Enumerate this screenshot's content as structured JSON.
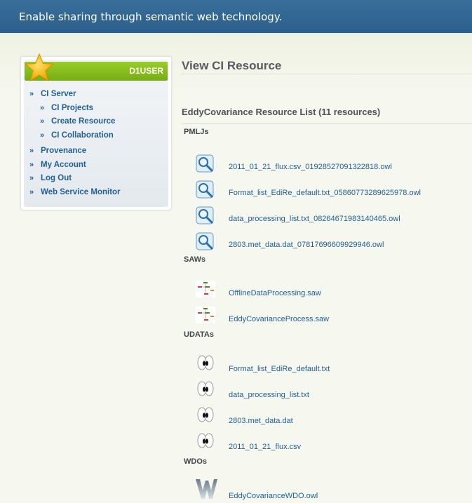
{
  "header": {
    "tagline": "Enable sharing through semantic web technology."
  },
  "sidebar": {
    "username": "D1USER",
    "items": [
      {
        "label": "CI Server"
      },
      {
        "label": "CI Projects"
      },
      {
        "label": "Create Resource"
      },
      {
        "label": "CI Collaboration"
      },
      {
        "label": "Provenance"
      },
      {
        "label": "My Account"
      },
      {
        "label": "Log Out"
      },
      {
        "label": "Web Service Monitor"
      }
    ]
  },
  "main": {
    "title": "View CI Resource",
    "list_heading": "EddyCovariance Resource List (11 resources)",
    "sections": [
      {
        "label": "PMLJs",
        "icon": "magnifier-icon",
        "files": [
          "2011_01_21_flux.csv_01928527091322818.owl",
          "Format_list_EdiRe_default.txt_05860773289625978.owl",
          "data_processing_list.txt_08264671983140465.owl",
          "2803.met_data.dat_07817696609929946.owl"
        ]
      },
      {
        "label": "SAWs",
        "icon": "workflow-diagram-icon",
        "files": [
          "OfflineDataProcessing.saw",
          "EddyCovarianceProcess.saw"
        ]
      },
      {
        "label": "UDATAs",
        "icon": "eyes-icon",
        "files": [
          "Format_list_EdiRe_default.txt",
          "data_processing_list.txt",
          "2803.met_data.dat",
          "2011_01_21_flux.csv"
        ]
      },
      {
        "label": "WDOs",
        "icon": "w-letter-icon",
        "files": [
          "EddyCovarianceWDO.owl"
        ]
      }
    ]
  }
}
